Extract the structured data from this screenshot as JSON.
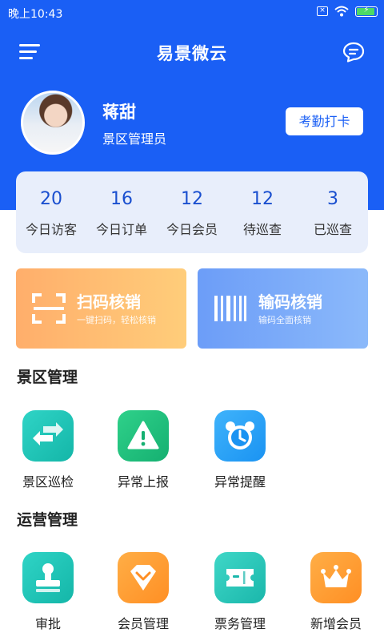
{
  "status_bar": {
    "time": "晚上10:43",
    "sim_label": "×"
  },
  "header": {
    "title": "易景微云"
  },
  "profile": {
    "name": "蒋甜",
    "role": "景区管理员",
    "checkin_label": "考勤打卡"
  },
  "stats": [
    {
      "value": "20",
      "label": "今日访客"
    },
    {
      "value": "16",
      "label": "今日订单"
    },
    {
      "value": "12",
      "label": "今日会员"
    },
    {
      "value": "12",
      "label": "待巡查"
    },
    {
      "value": "3",
      "label": "已巡查"
    }
  ],
  "actions": {
    "scan": {
      "title": "扫码核销",
      "subtitle": "一键扫码，轻松核销",
      "icon": "scan-icon"
    },
    "code": {
      "title": "输码核销",
      "subtitle": "输码全面核销",
      "icon": "barcode-icon"
    }
  },
  "scenic_section": {
    "title": "景区管理",
    "items": [
      {
        "label": "景区巡检",
        "icon": "arrows-icon"
      },
      {
        "label": "异常上报",
        "icon": "warning-icon"
      },
      {
        "label": "异常提醒",
        "icon": "alarm-clock-icon"
      }
    ]
  },
  "ops_section": {
    "title": "运营管理",
    "items": [
      {
        "label": "审批",
        "icon": "stamp-icon"
      },
      {
        "label": "会员管理",
        "icon": "diamond-icon"
      },
      {
        "label": "票务管理",
        "icon": "ticket-icon"
      },
      {
        "label": "新增会员",
        "icon": "crown-icon"
      }
    ]
  },
  "colors": {
    "primary": "#1a5ff5",
    "stat_value": "#1a4fcf",
    "card_bg": "#e8eefb"
  }
}
